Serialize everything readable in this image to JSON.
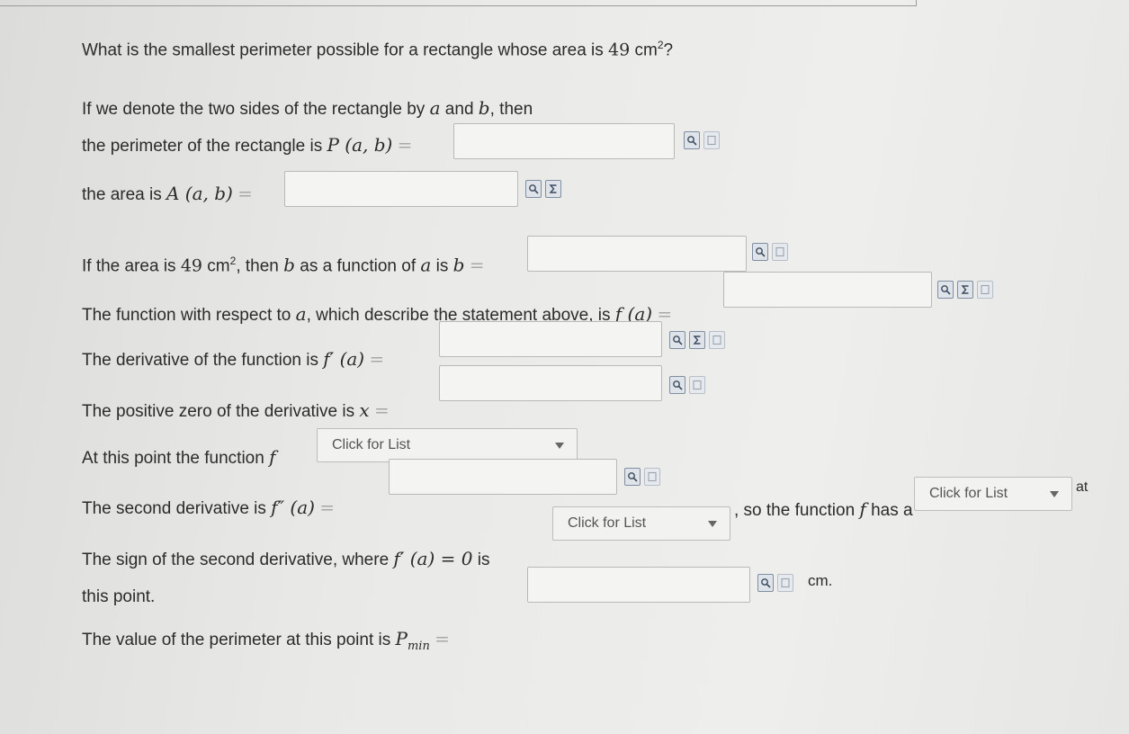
{
  "question": {
    "prefix": "What is the smallest perimeter possible for a rectangle whose area is ",
    "area_value": "49",
    "unit": "cm",
    "exp": "2",
    "suffix": "?"
  },
  "rows": {
    "denote": {
      "text1": "If we denote the two sides of the rectangle ",
      "text2": "by ",
      "a": "a",
      "and": " and ",
      "b": "b",
      "then": ", then"
    },
    "perimeter": {
      "label": "the perimeter of the rectangle is ",
      "func": "P (a, b)",
      "eq": "=",
      "value": ""
    },
    "area": {
      "label": "the area is ",
      "func": "A (a, b)",
      "eq": "=",
      "value": ""
    },
    "b_of_a": {
      "t1": "If the area is ",
      "num": "49",
      "unit": " cm",
      "exp": "2",
      "t2": ", then ",
      "b": "b",
      "t3": " as a function of ",
      "a": "a",
      "t4": " is ",
      "b2": "b",
      "eq": "=",
      "value": ""
    },
    "fa": {
      "t1": "The function with respect to ",
      "a": "a",
      "t2": ", which describe the statement above, is ",
      "func": "f (a)",
      "eq": "=",
      "value": ""
    },
    "deriv": {
      "label": "The derivative of the function is ",
      "func": "f′ (a)",
      "eq": "=",
      "value": ""
    },
    "zero": {
      "label": "The positive zero of the derivative is ",
      "x": "x",
      "eq": "=",
      "value": ""
    },
    "point": {
      "label": "At this point the function ",
      "f": "f",
      "dropdown": "Click for List"
    },
    "second": {
      "label": "The second derivative is ",
      "func": "f″ (a)",
      "eq": "=",
      "value": ""
    },
    "sign": {
      "t1": "The sign of the second derivative, where ",
      "func": "f′ (a) = 0",
      "t2": " is",
      "dropdown1": "Click for List",
      "t3": ", so the function ",
      "f": "f",
      "t4": " has a",
      "dropdown2": "Click for List",
      "t5": "at",
      "t6": "this point."
    },
    "pmin": {
      "label": "The value of the perimeter at this point is ",
      "P": "P",
      "min": "min",
      "eq": "=",
      "value": "",
      "unit": "cm."
    }
  }
}
